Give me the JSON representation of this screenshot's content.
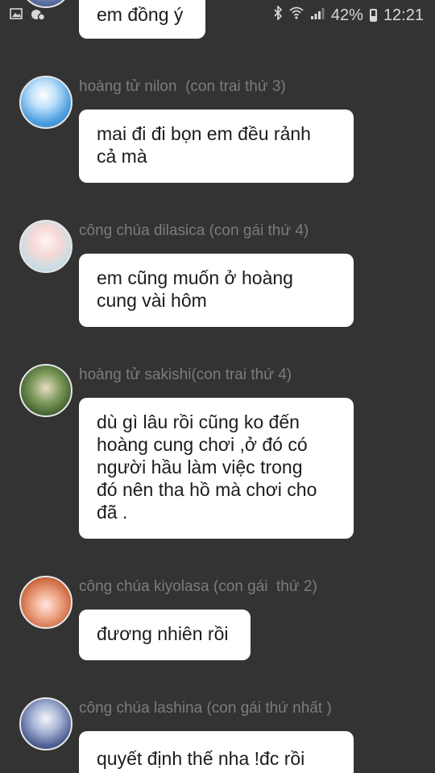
{
  "status_bar": {
    "battery_percent": "42%",
    "time": "12:21",
    "icons": [
      "image-icon",
      "notification-icon",
      "bluetooth-icon",
      "wifi-icon",
      "signal-icon",
      "battery-icon"
    ]
  },
  "colors": {
    "background": "#333333",
    "bubble": "#ffffff",
    "sender_text": "#7c7c7c"
  },
  "messages": [
    {
      "sender": "",
      "text": "em đồng ý"
    },
    {
      "sender": "hoàng tử nilon  (con trai thứ 3)",
      "text": "mai đi đi bọn em đều rảnh\ncả mà"
    },
    {
      "sender": "công chúa dilasica (con gái thứ 4)",
      "text": "em cũng muốn ở hoàng\ncung vài hôm"
    },
    {
      "sender": "hoàng tử sakishi(con trai thứ 4)",
      "text": "dù gì lâu rồi cũng ko đến\nhoàng cung chơi ,ở đó có\nngười hầu làm việc trong\nđó nên tha hồ mà chơi cho\nđã ."
    },
    {
      "sender": "công chúa kiyolasa (con gái  thứ 2)",
      "text": "đương nhiên rồi"
    },
    {
      "sender": "công chúa lashina (con gái thứ nhất )",
      "text": "quyết định thế nha !đc rồi"
    }
  ]
}
